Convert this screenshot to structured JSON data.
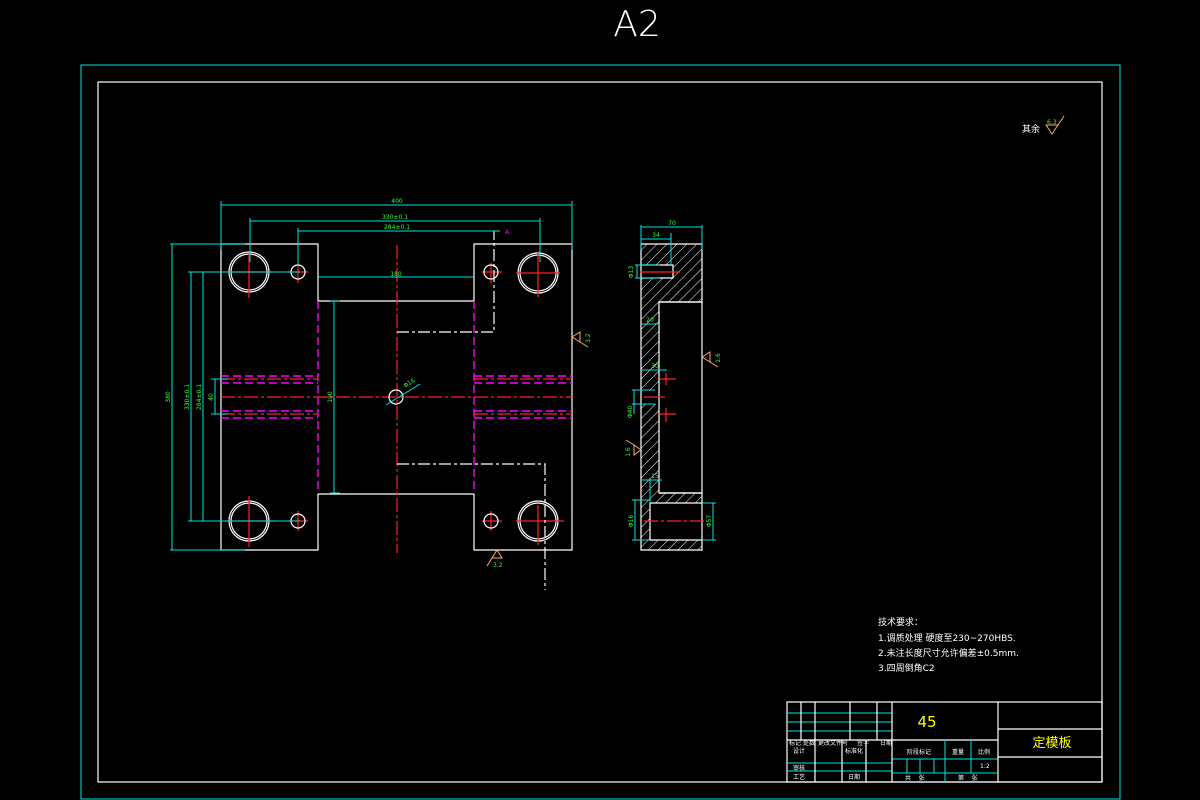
{
  "sheet_size": "A2",
  "roughness_general": {
    "label": "其余",
    "value": "6.3"
  },
  "front_view_dims": {
    "overall_width": "400",
    "hole_span_1": "330±0.1",
    "hole_span_2": "284±0.1",
    "center_gap": "180",
    "overall_height": "380",
    "hole_vspan_1": "330±0.1",
    "hole_vspan_2": "284±0.1",
    "slot_width": "40",
    "center_height": "190",
    "center_hole": "Φ16"
  },
  "side_view_dims": {
    "thickness": "70",
    "counterbore_depth": "34",
    "wall": "20",
    "step": "30",
    "slot_dia": "Φ40",
    "bottom_step": "15",
    "hole_a": "Φ16",
    "hole_b": "Φ13",
    "hole_c": "Φ57"
  },
  "roughness_marks": [
    "3.2",
    "3.2",
    "1.6",
    "1.6"
  ],
  "section_marker": "A",
  "technical_requirements": {
    "title": "技术要求：",
    "items": [
      "1.调质处理 硬度至230~270HBS.",
      "2.未注长度尺寸允许偏差±0.5mm.",
      "3.四周倒角C2"
    ]
  },
  "title_block": {
    "material": "45",
    "part_name": "定模板",
    "headers": [
      "标记",
      "处数",
      "更改文件号",
      "签字",
      "日期"
    ],
    "designer_label": "设计",
    "standardization_label": "标准化",
    "review_label": "审核",
    "process_label": "工艺",
    "date_label": "日期",
    "stage_label": "阶段标记",
    "weight_label": "重量",
    "scale_label": "比例",
    "scale": "1:2",
    "sheets_total": "共    张",
    "sheet_no": "第    张"
  }
}
